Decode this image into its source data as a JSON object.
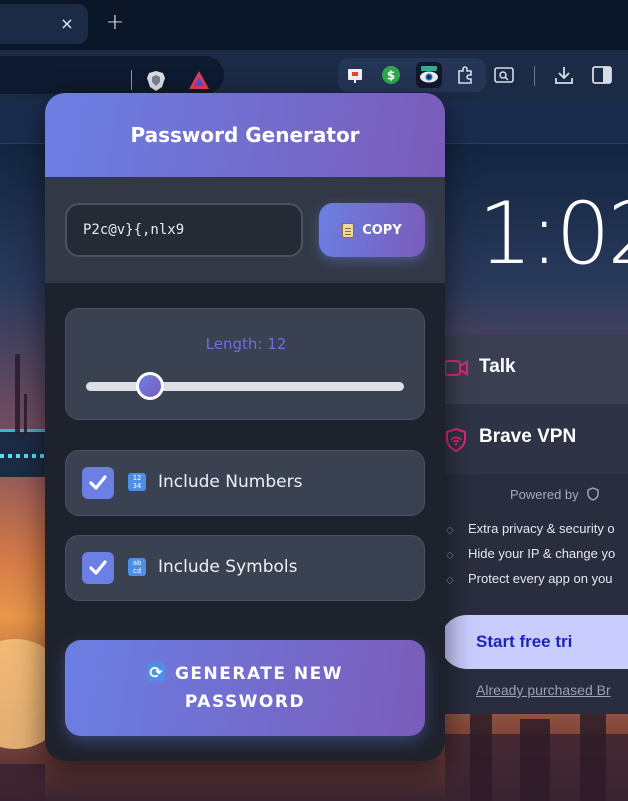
{
  "browser": {
    "tab_close_glyph": "×",
    "new_tab_glyph": "+"
  },
  "ntp": {
    "clock": "1:02",
    "vpn_widget": {
      "talk_label": "Talk",
      "vpn_label": "Brave VPN",
      "powered_by": "Powered by",
      "features": [
        "Extra privacy & security o",
        "Hide your IP & change yo",
        "Protect every app on you"
      ],
      "trial_button": "Start free tri",
      "purchased_link": "Already purchased Br",
      "accent_color": "#e0286e"
    }
  },
  "popup": {
    "title": "Password Generator",
    "password": "P2c@v}{,nlx9",
    "copy_label": "COPY",
    "length_label": "Length: 12",
    "length_fraction": 0.2,
    "options": [
      {
        "label": "Include Numbers",
        "checked": true,
        "icon": "input-numbers-icon",
        "icon_text": "12\n34"
      },
      {
        "label": "Include Symbols",
        "checked": true,
        "icon": "input-latin-icon",
        "icon_text": "ab\ncd"
      }
    ],
    "generate_label": "GENERATE NEW PASSWORD",
    "accent_color": "#6b7fe4",
    "accent_color_end": "#7a5cb9"
  }
}
